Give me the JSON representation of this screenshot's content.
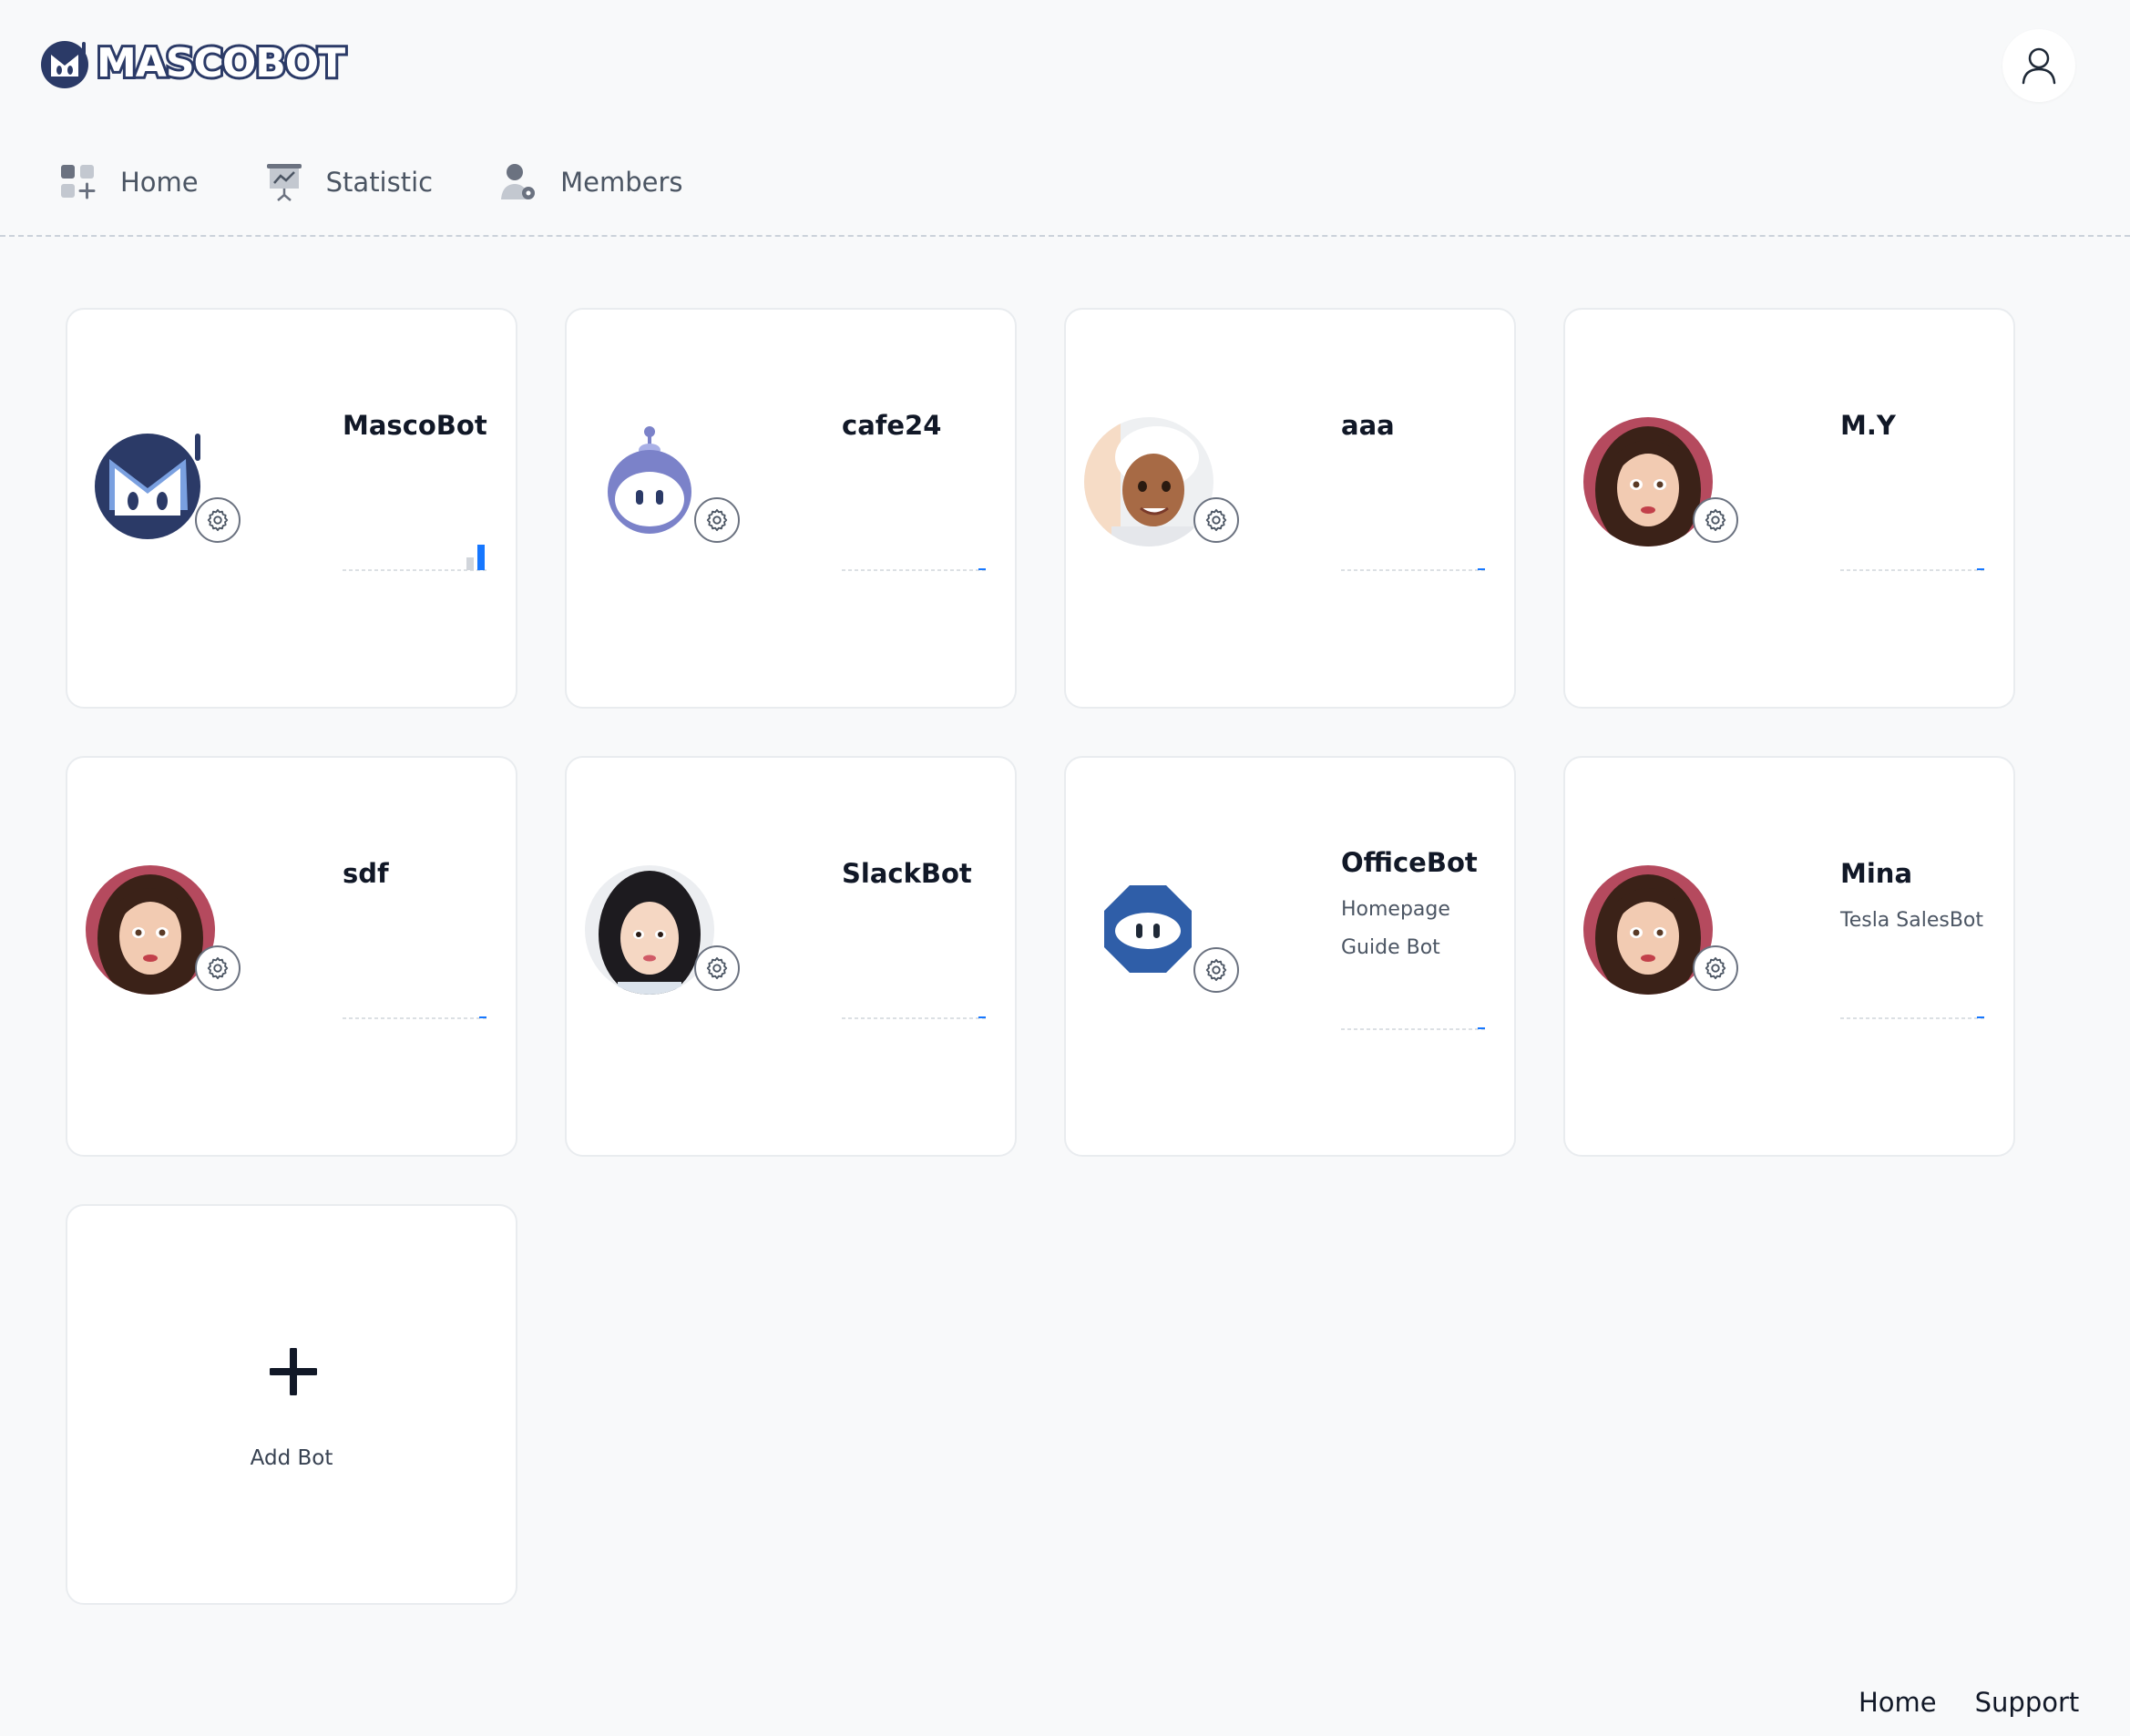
{
  "header": {
    "logo_text": "MASCOBOT",
    "user_icon": "user-icon"
  },
  "nav": {
    "items": [
      {
        "label": "Home",
        "icon": "dashboard-icon"
      },
      {
        "label": "Statistic",
        "icon": "presentation-chart-icon"
      },
      {
        "label": "Members",
        "icon": "member-settings-icon"
      }
    ]
  },
  "bots": [
    {
      "name": "MascoBot",
      "desc": [],
      "avatar": "mascobot-avatar",
      "active": true
    },
    {
      "name": "cafe24",
      "desc": [],
      "avatar": "robot-avatar",
      "active": false
    },
    {
      "name": "aaa",
      "desc": [],
      "avatar": "chef-avatar",
      "active": false
    },
    {
      "name": "M.Y",
      "desc": [],
      "avatar": "girl-avatar",
      "active": false
    },
    {
      "name": "sdf",
      "desc": [],
      "avatar": "girl-avatar",
      "active": false
    },
    {
      "name": "SlackBot",
      "desc": [],
      "avatar": "woman-avatar",
      "active": false
    },
    {
      "name": "OfficeBot",
      "desc": [
        "Homepage",
        "Guide Bot"
      ],
      "avatar": "office-avatar",
      "active": false
    },
    {
      "name": "Mina",
      "desc": [
        "Tesla SalesBot"
      ],
      "avatar": "girl-avatar",
      "active": false
    }
  ],
  "add_bot": {
    "label": "Add Bot"
  },
  "footer": {
    "links": [
      "Home",
      "Support"
    ]
  },
  "colors": {
    "accent": "#1677ff",
    "brand_navy": "#2b3a67",
    "background": "#f8f9fa"
  }
}
